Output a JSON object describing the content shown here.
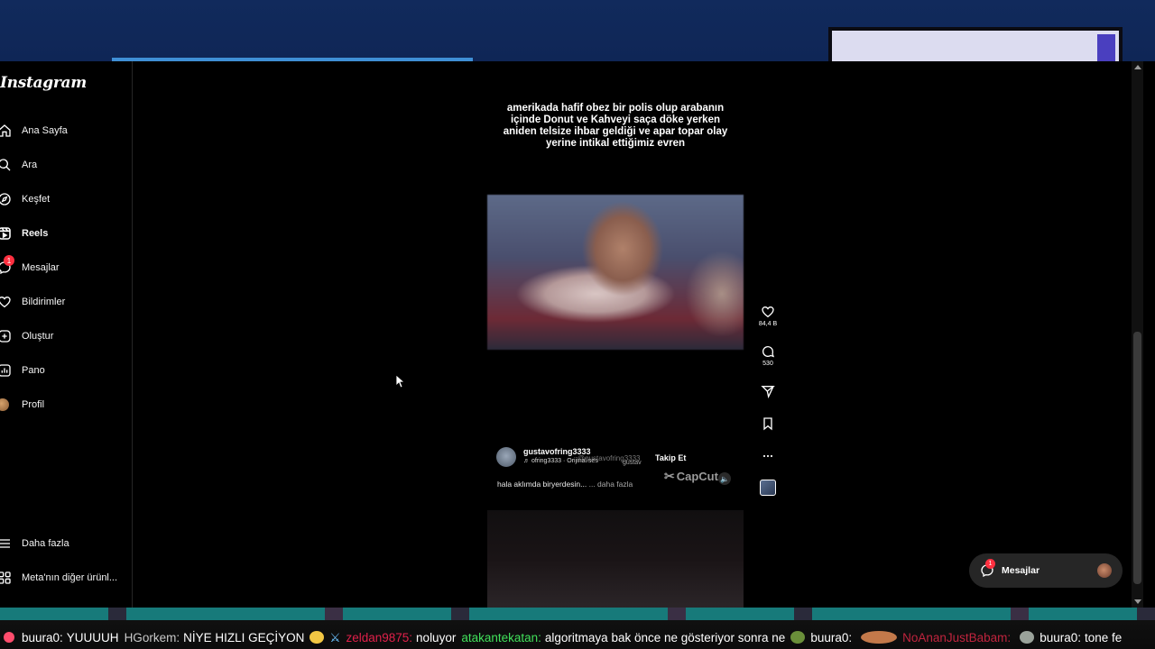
{
  "app": {
    "name": "Instagram"
  },
  "sidebar": {
    "items": [
      {
        "label": "Ana Sayfa",
        "icon": "home-icon",
        "active": false
      },
      {
        "label": "Ara",
        "icon": "search-icon",
        "active": false
      },
      {
        "label": "Keşfet",
        "icon": "compass-icon",
        "active": false
      },
      {
        "label": "Reels",
        "icon": "reels-icon",
        "active": true
      },
      {
        "label": "Mesajlar",
        "icon": "messenger-icon",
        "active": false,
        "badge": "1"
      },
      {
        "label": "Bildirimler",
        "icon": "heart-icon",
        "active": false
      },
      {
        "label": "Oluştur",
        "icon": "plus-square-icon",
        "active": false
      },
      {
        "label": "Pano",
        "icon": "dashboard-icon",
        "active": false
      },
      {
        "label": "Profil",
        "icon": "avatar",
        "active": false
      }
    ],
    "bottom_items": [
      {
        "label": "Daha fazla",
        "icon": "menu-icon"
      },
      {
        "label": "Meta'nın diğer ürünl...",
        "icon": "grid-icon"
      }
    ]
  },
  "reel": {
    "overlay_text": "amerikada hafif obez bir polis olup arabanın içinde Donut ve Kahveyi saça döke yerken aniden telsize ihbar geldiği ve apar topar olay yerine intikal ettiğimiz evren",
    "username": "gustavofring3333",
    "audio": "♬ ofring3333 · Orijinal ses",
    "ghost_text": "@gustavofring3333",
    "ghost_text2": "gustav",
    "follow_label": "Takip Et",
    "watermark": "CapCut",
    "caption": "hala aklımda biryerdesin... ",
    "more_label": "... daha fazla",
    "likes": "84,4 B",
    "comments": "530"
  },
  "dm_pill": {
    "label": "Mesajlar",
    "badge": "1"
  },
  "chat": [
    {
      "user": "buura0:",
      "message": "YUUUUH",
      "user_color": "#ffffff"
    },
    {
      "user": "HGorkem:",
      "message": "NİYE HIZLI GEÇİYON",
      "user_color": "#c9c9c9"
    },
    {
      "user": "zeldan9875:",
      "message": "noluyor",
      "user_color": "#e0204a"
    },
    {
      "user": "atakantekatan:",
      "message": "algoritmaya bak önce ne gösteriyor sonra ne",
      "user_color": "#41e05a"
    },
    {
      "user": "buura0:",
      "message": "",
      "user_color": "#ffffff"
    },
    {
      "user": "NoAnanJustBabam:",
      "message": "",
      "user_color": "#c0243e"
    },
    {
      "user": "buura0:",
      "message": "tone fe",
      "user_color": "#ffffff"
    }
  ],
  "colors": {
    "accent_red": "#ff3040",
    "link_gray": "#a8a8a8",
    "band_top": "#112a5c",
    "band_bottom": "#177a7a"
  }
}
